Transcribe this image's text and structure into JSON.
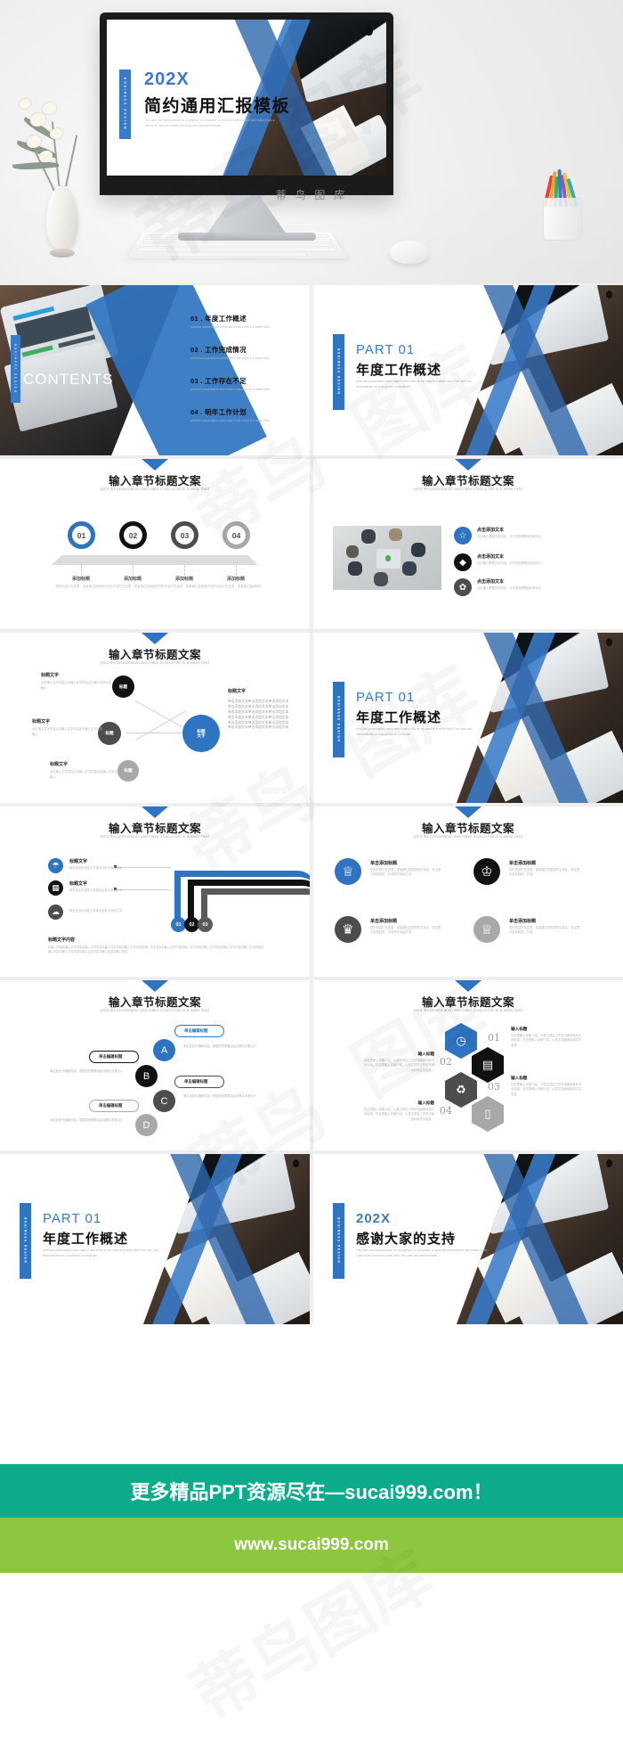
{
  "cover": {
    "year": "202X",
    "title": "简约通用汇报模板",
    "desc": "The user can demonstrate on a projector or computer, or print the presentation and make it into a film to be used in a wider field.The user can demonstrate.",
    "side_tab": "BUSINESS DESIGN",
    "watermark_label": "蒂 鸟 图 库"
  },
  "contents": {
    "heading": "CONTENTS",
    "side_tab": "BUSINESS DESIGN",
    "items": [
      {
        "num": "01 .",
        "label": "年度工作概述",
        "desc": "print the presentation and make it into a film in a wider field"
      },
      {
        "num": "02 .",
        "label": "工作完成情况",
        "desc": "print the presentation and make it into a film in a wider field"
      },
      {
        "num": "03 .",
        "label": "工作存在不足",
        "desc": "print the presentation and make it into a film in a wider field"
      },
      {
        "num": "04 .",
        "label": "明年工作计划",
        "desc": "print the presentation and make it into a film in a wider field"
      }
    ]
  },
  "part_slide": {
    "kicker": "PART 01",
    "title": "年度工作概述",
    "desc": "print the presentation and make it into a film to be used in a wider field.The user can demonstrate on a projector or computer",
    "side_tab": "BUSINESS DESIGN"
  },
  "thanks_slide": {
    "kicker": "202X",
    "title": "感谢大家的支持",
    "desc": "The user can demonstrate on a projector or computer, or print the presentation and make it into a film to be used in a wider field.The user can demonstrate",
    "side_tab": "BUSINESS DESIGN"
  },
  "section_title": "输入章节标题文案",
  "section_sub": "print the presentation and make it into a film in a wider field",
  "steps_slide": {
    "steps": [
      {
        "num": "01",
        "color": "#2f74c0",
        "head": "添加标题",
        "body": "您的内容打在这里，或者通过复制您的"
      },
      {
        "num": "02",
        "color": "#111111",
        "head": "添加标题",
        "body": "您的内容打在这里，或者通过复制您的"
      },
      {
        "num": "03",
        "color": "#4d4d4d",
        "head": "添加标题",
        "body": "您的内容打在这里，或者通过复制您的"
      },
      {
        "num": "04",
        "color": "#a8a8a8",
        "head": "添加标题",
        "body": "您的内容打在这里，或者通过复制您的"
      }
    ]
  },
  "photo_list_slide": {
    "items": [
      {
        "icon": "star-icon",
        "glyph": "☆",
        "color": "#2f74c0",
        "head": "点击添加文本",
        "body": "点击输入需要文本内容，文字内容需概括精炼设计…"
      },
      {
        "icon": "diamond-icon",
        "glyph": "◆",
        "color": "#111111",
        "head": "点击添加文本",
        "body": "点击输入需要文本内容，文字内容需概括精炼设计…"
      },
      {
        "icon": "gear-icon",
        "glyph": "✿",
        "color": "#4d4d4d",
        "head": "点击添加文本",
        "body": "点击输入需要文本内容，文字内容需概括精炼设计…"
      }
    ]
  },
  "mindmap_slide": {
    "center": "标题\n文字",
    "center_color": "#2f74c0",
    "nodes": [
      {
        "chip": "标题",
        "color": "#111111",
        "head": "标题文字",
        "body": "点击输入文字内容点击输入文字内容点击输入文字点击输入"
      },
      {
        "chip": "标题",
        "color": "#4d4d4d",
        "head": "标题文字",
        "body": "点击输入文字内容点击输入文字内容点击输入文字点击输入"
      },
      {
        "chip": "标题",
        "color": "#a8a8a8",
        "head": "标题文字",
        "body": "点击输入文字内容点击输入文字内容点击输入文字点击输入"
      }
    ],
    "side": {
      "head": "标题文字",
      "lines": [
        "单击添加文本单击添加文本单击添加文本",
        "单击添加文本单击添加文本单击添加文本",
        "单击添加文本单击添加文本单击添加文本",
        "单击添加文本单击添加文本单击添加文本",
        "单击添加文本单击添加文本单击添加文本",
        "单击添加文本单击添加文本单击添加文本"
      ]
    }
  },
  "pipe_slide": {
    "items": [
      {
        "icon": "umbrella-icon",
        "glyph": "☂",
        "color": "#2f74c0",
        "head": "标题文字",
        "body": "单击此处可添加文本单击此处可添加文本"
      },
      {
        "icon": "grid-icon",
        "glyph": "▦",
        "color": "#111111",
        "head": "标题文字",
        "body": "单击此处可添加文本单击此处可添加文本"
      },
      {
        "icon": "cloud-icon",
        "glyph": "☁",
        "color": "#4d4d4d",
        "head": "",
        "body": "单击此处可添加文本单击此处可添加文本"
      }
    ],
    "pills": [
      {
        "num": "01",
        "color": "#2f74c0"
      },
      {
        "num": "02",
        "color": "#111111"
      },
      {
        "num": "03",
        "color": "#4d4d4d"
      }
    ],
    "footer_head": "标题文字内容",
    "footer_body": "请输入内容请输入文字内容请输入文字内容请输入文字内容请输入文字内容请输入文字内容请输入文字内容请输入文字内容请输入文字内容请输入文字内容请输入文字内容请输入内容请输入文字内容请输入文字内容请输入内容请输入内容"
  },
  "crown_slide": {
    "items": [
      {
        "icon": "crown-filled-icon",
        "glyph": "♕",
        "color": "#2f74c0",
        "head": "单击添加标题",
        "body": "您的内容打在这里，或者通过复制您的文本区，在这里中选择粘贴，并选择只保留文字。"
      },
      {
        "icon": "chess-king-icon",
        "glyph": "♔",
        "color": "#111111",
        "head": "单击添加标题",
        "body": "您的内容打在这里，或者通过复制您的文本区，在这里中选择粘贴，并选…"
      },
      {
        "icon": "crown-outline-icon",
        "glyph": "♛",
        "color": "#4d4d4d",
        "head": "单击添加标题",
        "body": "您的内容打在这里，或者通过复制您的文本区，在这里中选择粘贴，并选择只保留文字。"
      },
      {
        "icon": "crown-grey-icon",
        "glyph": "♕",
        "color": "#a8a8a8",
        "head": "单击添加标题",
        "body": "您的内容打在这里，或者通过复制您的文本区，在这里中选择粘贴，并选…"
      }
    ]
  },
  "abcd_slide": {
    "items": [
      {
        "letter": "A",
        "color": "#2f74c0",
        "cap": "单击编辑标题",
        "body": "单击此处可编辑内容，根据您的需要自由拉伸文本框大小"
      },
      {
        "letter": "B",
        "color": "#111111",
        "cap": "单击编辑标题",
        "body": "单击此处可编辑内容，根据您的需要自由拉伸文本框大小"
      },
      {
        "letter": "C",
        "color": "#4d4d4d",
        "cap": "单击编辑标题",
        "body": "单击此处可编辑内容，根据您的需要自由拉伸文本框大小"
      },
      {
        "letter": "D",
        "color": "#a8a8a8",
        "cap": "单击编辑标题",
        "body": "单击此处可编辑内容，根据您的需要自由拉伸文本框大小"
      }
    ]
  },
  "hex_slide": {
    "items": [
      {
        "icon": "clock-icon",
        "glyph": "◷",
        "color": "#2f74c0",
        "num": "01",
        "head": "输入标题",
        "body": "在这里输入详细介绍，以表达项目工作的详细资料和文字信息。在这里输入详细介绍，以表达详细资料和文字信息。"
      },
      {
        "icon": "calendar-icon",
        "glyph": "▤",
        "color": "#111111",
        "num": "02",
        "head": "输入标题",
        "body": "在这里输入详细介绍，以表达项目工作的详细资料和文字信息。在这里输入详细介绍，以表达项目工作的详细资料和文字信息。"
      },
      {
        "icon": "recycle-icon",
        "glyph": "♻",
        "color": "#4d4d4d",
        "num": "03",
        "head": "输入标题",
        "body": "在这里输入详细介绍，以表达项目工作的详细资料和文字信息。在这里输入详细介绍，以表达详细资料和文字信息。"
      },
      {
        "icon": "document-icon",
        "glyph": "▯",
        "color": "#a8a8a8",
        "num": "04",
        "head": "输入标题",
        "body": "在这里输入详细介绍，以表达项目工作的详细资料和文字信息。在这里输入详细介绍，以表达项目工作的详细资料和文字信息。"
      }
    ]
  },
  "footer": {
    "banner_top": "更多精品PPT资源尽在—sucai999.com！",
    "banner_top_color": "#0cab8b",
    "banner_bottom": "www.sucai999.com",
    "banner_bottom_color": "#8dc63f"
  },
  "watermark": "蒂鸟图库"
}
